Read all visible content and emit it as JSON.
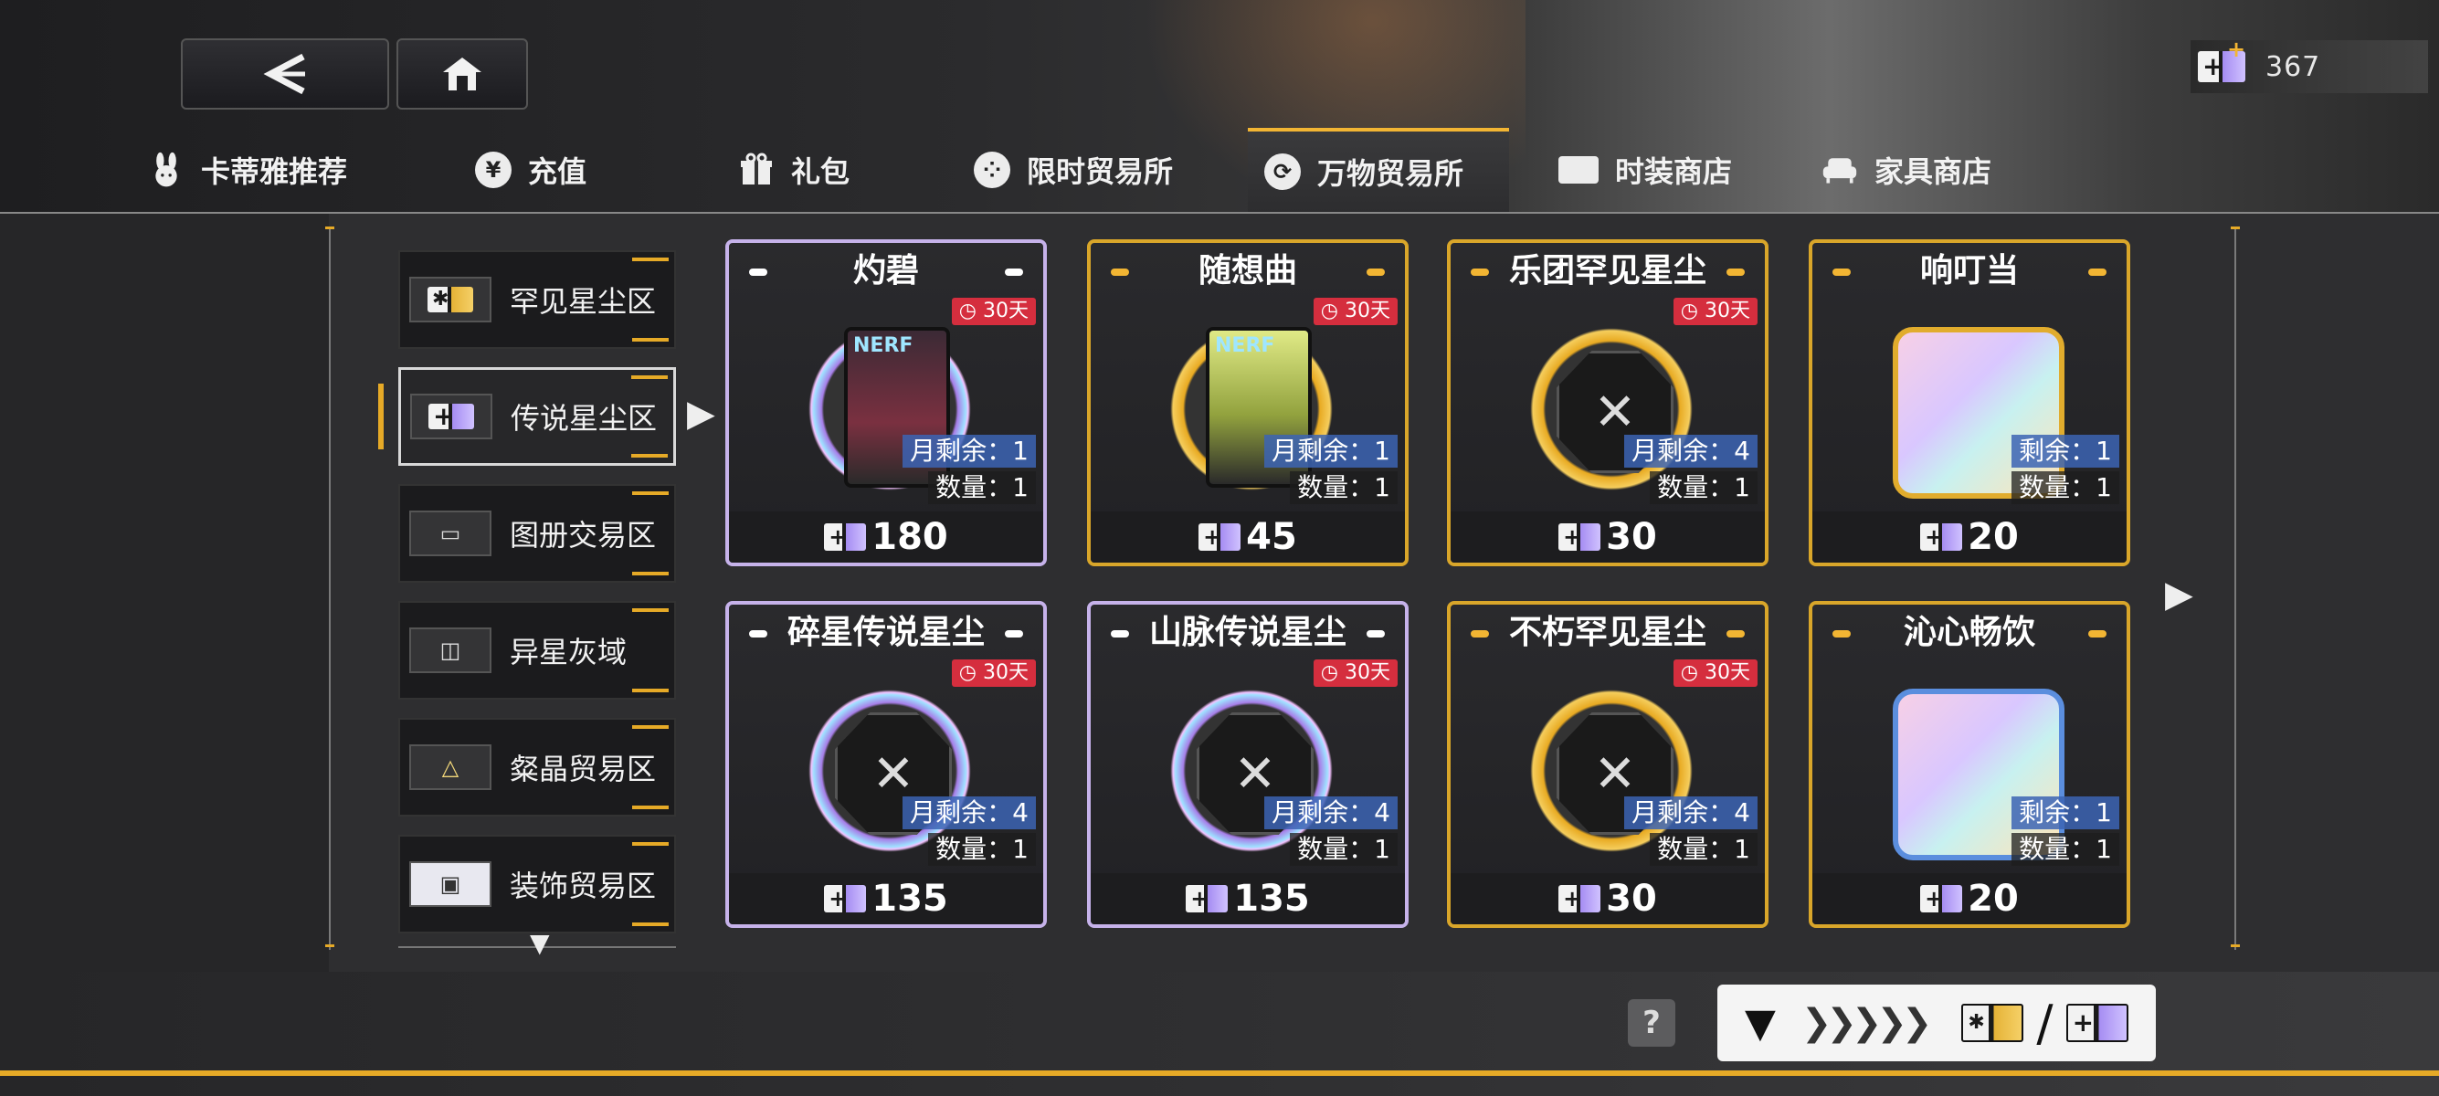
{
  "header": {
    "back_icon": "back-arrow-icon",
    "home_icon": "home-icon",
    "currency_value": "367"
  },
  "tabs": [
    {
      "label": "卡蒂雅推荐",
      "icon": "rabbit-icon",
      "active": false
    },
    {
      "label": "充值",
      "icon": "yen-icon",
      "active": false
    },
    {
      "label": "礼包",
      "icon": "gift-icon",
      "active": false
    },
    {
      "label": "限时贸易所",
      "icon": "limited-trade-icon",
      "active": false
    },
    {
      "label": "万物贸易所",
      "icon": "exchange-icon",
      "active": true
    },
    {
      "label": "时装商店",
      "icon": "outfit-icon",
      "active": false
    },
    {
      "label": "家具商店",
      "icon": "sofa-icon",
      "active": false
    }
  ],
  "sidebar": [
    {
      "label": "罕见星尘区",
      "icon": "rare-dust-icon",
      "active": false
    },
    {
      "label": "传说星尘区",
      "icon": "legend-dust-icon",
      "active": true
    },
    {
      "label": "图册交易区",
      "icon": "album-icon",
      "active": false
    },
    {
      "label": "异星灰域",
      "icon": "gray-zone-icon",
      "active": false
    },
    {
      "label": "粲晶贸易区",
      "icon": "crystal-icon",
      "active": false
    },
    {
      "label": "装饰贸易区",
      "icon": "decoration-icon",
      "active": false
    }
  ],
  "cards": [
    {
      "title": "灼碧",
      "timer": "30天",
      "remain": "月剩余：1",
      "qty": "数量：1",
      "price": "180",
      "style": "purple",
      "art": "card-art"
    },
    {
      "title": "随想曲",
      "timer": "30天",
      "remain": "月剩余：1",
      "qty": "数量：1",
      "price": "45",
      "style": "gold",
      "art": "card-art-green"
    },
    {
      "title": "乐团罕见星尘",
      "timer": "30天",
      "remain": "月剩余：4",
      "qty": "数量：1",
      "price": "30",
      "style": "gold",
      "art": "emblem"
    },
    {
      "title": "响叮当",
      "timer": "",
      "remain": "剩余：1",
      "qty": "数量：1",
      "price": "20",
      "style": "gold",
      "art": "frame"
    },
    {
      "title": "碎星传说星尘",
      "timer": "30天",
      "remain": "月剩余：4",
      "qty": "数量：1",
      "price": "135",
      "style": "purple",
      "art": "emblem"
    },
    {
      "title": "山脉传说星尘",
      "timer": "30天",
      "remain": "月剩余：4",
      "qty": "数量：1",
      "price": "135",
      "style": "purple",
      "art": "emblem"
    },
    {
      "title": "不朽罕见星尘",
      "timer": "30天",
      "remain": "月剩余：4",
      "qty": "数量：1",
      "price": "30",
      "style": "gold",
      "art": "emblem"
    },
    {
      "title": "沁心畅饮",
      "timer": "",
      "remain": "剩余：1",
      "qty": "数量：1",
      "price": "20",
      "style": "gold",
      "art": "frame-blue"
    }
  ],
  "card_texts": {
    "nerf_label": "NERF"
  },
  "footer": {
    "help_label": "?",
    "exchange_slash": "/"
  },
  "colors": {
    "accent": "#e6aa27",
    "timer_red": "#d52e3e",
    "remain_blue": "#3c64b4",
    "legend_purple": "#a58cf2"
  }
}
